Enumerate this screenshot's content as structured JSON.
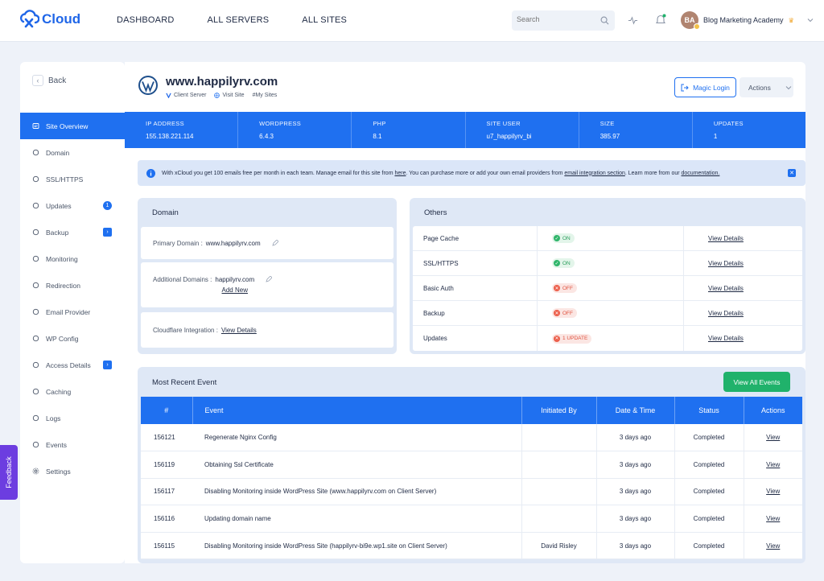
{
  "brand": {
    "name": "Cloud",
    "accent": "#1f70f0"
  },
  "nav": [
    "DASHBOARD",
    "ALL SERVERS",
    "ALL SITES"
  ],
  "search": {
    "placeholder": "Search"
  },
  "user": {
    "initials": "BA",
    "name": "Blog Marketing Academy"
  },
  "sidebar": {
    "back_label": "Back",
    "items": [
      {
        "label": "Site Overview",
        "icon": "overview-icon",
        "active": true
      },
      {
        "label": "Domain",
        "icon": "domain-icon"
      },
      {
        "label": "SSL/HTTPS",
        "icon": "shield-icon"
      },
      {
        "label": "Updates",
        "icon": "refresh-icon",
        "badge": "1"
      },
      {
        "label": "Backup",
        "icon": "backup-icon",
        "badge": "›"
      },
      {
        "label": "Monitoring",
        "icon": "monitor-icon"
      },
      {
        "label": "Redirection",
        "icon": "redirect-icon"
      },
      {
        "label": "Email Provider",
        "icon": "mail-icon"
      },
      {
        "label": "WP Config",
        "icon": "config-icon"
      },
      {
        "label": "Access Details",
        "icon": "key-icon",
        "badge": "›"
      },
      {
        "label": "Caching",
        "icon": "cache-icon"
      },
      {
        "label": "Logs",
        "icon": "logs-icon"
      },
      {
        "label": "Events",
        "icon": "events-icon"
      },
      {
        "label": "Settings",
        "icon": "gear-icon"
      }
    ]
  },
  "feedback_label": "Feedback",
  "site": {
    "title": "www.happilyrv.com",
    "server": "Client Server",
    "visit": "Visit Site",
    "tag": "#My Sites",
    "magic_login": "Magic Login",
    "actions": "Actions"
  },
  "info": [
    {
      "label": "IP ADDRESS",
      "value": "155.138.221.114"
    },
    {
      "label": "WORDPRESS",
      "value": "6.4.3"
    },
    {
      "label": "PHP",
      "value": "8.1"
    },
    {
      "label": "SITE USER",
      "value": "u7_happilyrv_bi"
    },
    {
      "label": "SIZE",
      "value": "385.97"
    },
    {
      "label": "UPDATES",
      "value": "1"
    }
  ],
  "notice": {
    "t1": "With xCloud you get 100 emails free per month in each team. Manage email for this site from ",
    "l1": "here",
    "t2": ". You can purchase more or add your own email providers from ",
    "l2": "email integration section",
    "t3": ". Learn more from our ",
    "l3": "documentation."
  },
  "domain": {
    "title": "Domain",
    "primary_label": "Primary Domain :",
    "primary_value": "www.happilyrv.com",
    "additional_label": "Additional Domains :",
    "additional_value": "happilyrv.com",
    "add_new": "Add New",
    "cloudflare_label": "Cloudflare Integration :",
    "cloudflare_link": "View Details"
  },
  "others": {
    "title": "Others",
    "rows": [
      {
        "name": "Page Cache",
        "status": "ON",
        "state": "on",
        "link": "View Details"
      },
      {
        "name": "SSL/HTTPS",
        "status": "ON",
        "state": "on",
        "link": "View Details"
      },
      {
        "name": "Basic Auth",
        "status": "OFF",
        "state": "off",
        "link": "View Details"
      },
      {
        "name": "Backup",
        "status": "OFF",
        "state": "off",
        "link": "View Details"
      },
      {
        "name": "Updates",
        "status": "1 UPDATE",
        "state": "off",
        "link": "View Details"
      }
    ]
  },
  "events": {
    "title": "Most Recent Event",
    "view_all": "View All Events",
    "columns": [
      "#",
      "Event",
      "Initiated By",
      "Date & Time",
      "Status",
      "Actions"
    ],
    "rows": [
      {
        "id": "156121",
        "event": "Regenerate Nginx Config",
        "by": "",
        "date": "3 days ago",
        "status": "Completed",
        "action": "View"
      },
      {
        "id": "156119",
        "event": "Obtaining Ssl Certificate",
        "by": "",
        "date": "3 days ago",
        "status": "Completed",
        "action": "View"
      },
      {
        "id": "156117",
        "event": "Disabling Monitoring inside WordPress Site (www.happilyrv.com on Client Server)",
        "by": "",
        "date": "3 days ago",
        "status": "Completed",
        "action": "View"
      },
      {
        "id": "156116",
        "event": "Updating domain name",
        "by": "",
        "date": "3 days ago",
        "status": "Completed",
        "action": "View"
      },
      {
        "id": "156115",
        "event": "Disabling Monitoring inside WordPress Site (happilyrv-bi9e.wp1.site on Client Server)",
        "by": "David Risley",
        "date": "3 days ago",
        "status": "Completed",
        "action": "View"
      }
    ]
  }
}
